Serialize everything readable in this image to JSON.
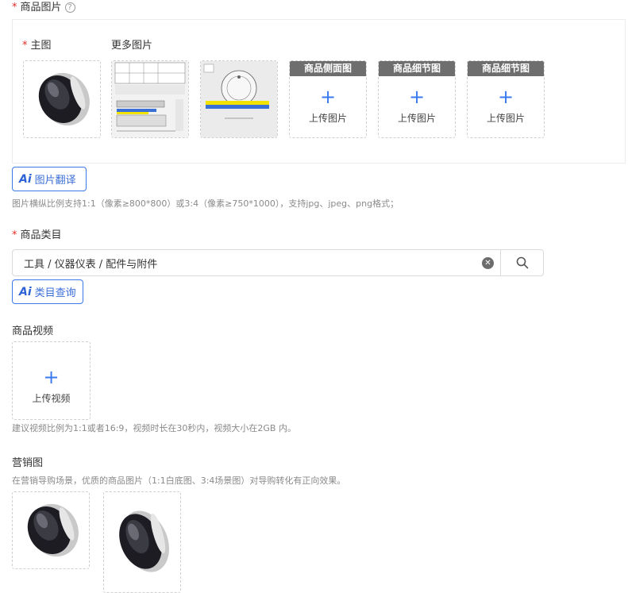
{
  "images_section": {
    "required_mark": "*",
    "label": "商品图片",
    "help_icon": "?",
    "main_image_label": "主图",
    "more_images_label": "更多图片",
    "slots": [
      {
        "title": "商品侧面图",
        "plus": "+",
        "text": "上传图片"
      },
      {
        "title": "商品细节图",
        "plus": "+",
        "text": "上传图片"
      },
      {
        "title": "商品细节图",
        "plus": "+",
        "text": "上传图片"
      }
    ],
    "ai_badge": "Ai",
    "translate_button": "图片翻译",
    "hint": "图片横纵比例支持1:1（像素≥800*800）或3:4（像素≥750*1000），支持jpg、jpeg、png格式；"
  },
  "category_section": {
    "required_mark": "*",
    "label": "商品类目",
    "value": "工具 / 仪器仪表 / 配件与附件",
    "clear_icon": "✕",
    "ai_badge": "Ai",
    "query_button": "类目查询"
  },
  "video_section": {
    "label": "商品视频",
    "plus": "+",
    "upload_text": "上传视频",
    "hint": "建议视频比例为1:1或者16:9，视频时长在30秒内，视频大小在2GB 内。"
  },
  "marketing_section": {
    "label": "营销图",
    "hint": "在营销导购场景，优质的商品图片（1:1白底图、3:4场景图）对导购转化有正向效果。"
  },
  "colors": {
    "required": "#e02e24",
    "accent_blue": "#3a79f0",
    "slot_header": "#6e6e6e"
  }
}
